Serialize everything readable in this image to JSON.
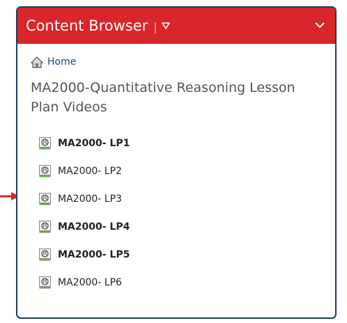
{
  "widget": {
    "title": "Content Browser",
    "separator": "|",
    "icons": {
      "menu": "dropdown-triangle-icon",
      "collapse": "chevron-down-icon"
    },
    "colors": {
      "header": "#d8262a",
      "border": "#1f3a5f",
      "link": "#1f4e79",
      "indicator_arrow": "#d8262a"
    }
  },
  "breadcrumb": {
    "home_label": "Home",
    "icon": "home-icon"
  },
  "folder": {
    "title": "MA2000-Quantitative Reasoning Lesson Plan Videos"
  },
  "topics": [
    {
      "label": "MA2000- LP1",
      "bold": true,
      "icon": "web-link-icon"
    },
    {
      "label": "MA2000- LP2",
      "bold": false,
      "icon": "web-link-icon"
    },
    {
      "label": "MA2000- LP3",
      "bold": false,
      "icon": "web-link-icon"
    },
    {
      "label": "MA2000- LP4",
      "bold": true,
      "icon": "web-link-icon"
    },
    {
      "label": "MA2000- LP5",
      "bold": true,
      "icon": "web-link-icon"
    },
    {
      "label": "MA2000- LP6",
      "bold": false,
      "icon": "web-link-icon"
    }
  ]
}
